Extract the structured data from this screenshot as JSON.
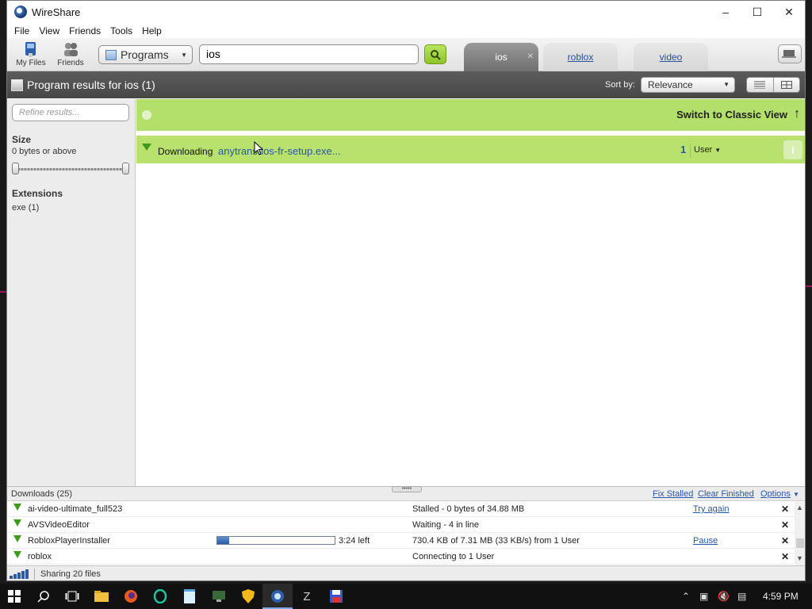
{
  "window": {
    "title": "WireShare"
  },
  "menubar": {
    "items": [
      "File",
      "View",
      "Friends",
      "Tools",
      "Help"
    ]
  },
  "toolbar": {
    "my_files_label": "My Files",
    "friends_label": "Friends",
    "category_select": "Programs",
    "search_value": "ios",
    "tabs": [
      {
        "label": "ios",
        "active": true
      },
      {
        "label": "roblox",
        "active": false
      },
      {
        "label": "video",
        "active": false
      }
    ]
  },
  "results_header": {
    "title": "Program results for ios (1)",
    "sort_label": "Sort by:",
    "sort_value": "Relevance"
  },
  "filters": {
    "refine_placeholder": "Refine results...",
    "size_heading": "Size",
    "size_value": "0 bytes or above",
    "extensions_heading": "Extensions",
    "extension_item": "exe (1)"
  },
  "content": {
    "classic_view_label": "Switch to Classic View",
    "result": {
      "status_label": "Downloading",
      "filename": "anytrans-ios-fr-setup.exe...",
      "count": "1",
      "user_label": "User",
      "info_icon": "i"
    }
  },
  "downloads": {
    "title": "Downloads (25)",
    "fix_stalled": "Fix Stalled",
    "clear_finished": "Clear Finished",
    "options": "Options",
    "rows": [
      {
        "name": "ai-video-ultimate_full523",
        "status": "Stalled - 0 bytes of 34.88 MB",
        "action": "Try again",
        "time": ""
      },
      {
        "name": "AVSVideoEditor",
        "status": "Waiting - 4 in line",
        "action": "",
        "time": ""
      },
      {
        "name": "RobloxPlayerInstaller",
        "status": "730.4 KB of 7.31 MB (33 KB/s) from 1 User",
        "action": "Pause",
        "time": "3:24 left",
        "progress": 0.1
      },
      {
        "name": "roblox",
        "status": "Connecting to 1 User",
        "action": "",
        "time": ""
      }
    ]
  },
  "statusbar": {
    "sharing": "Sharing 20 files"
  },
  "taskbar": {
    "clock": "4:59 PM"
  }
}
